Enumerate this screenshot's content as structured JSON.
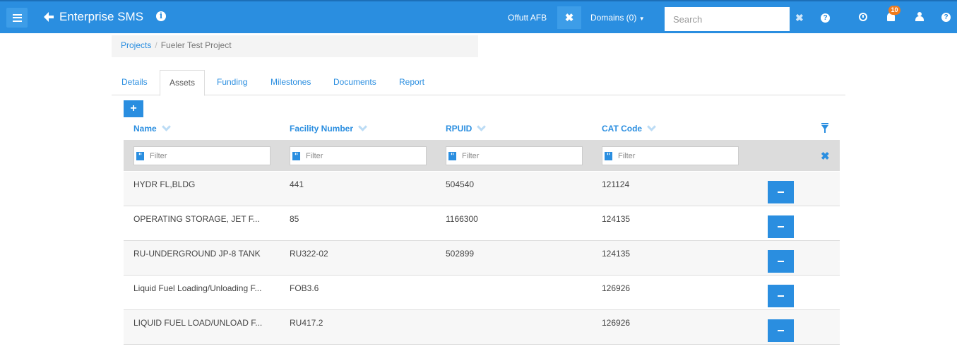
{
  "header": {
    "app_title": "Enterprise SMS",
    "base": "Offutt AFB",
    "domains_label": "Domains (0)",
    "search_placeholder": "Search",
    "notification_count": "10",
    "brand_color": "#2a8ee0",
    "icons": [
      "menu-icon",
      "logo-arrow-icon",
      "info-icon",
      "close-icon",
      "help-icon",
      "clock-icon",
      "bell-icon",
      "user-icon"
    ]
  },
  "breadcrumb": {
    "parent": "Projects",
    "separator": "/",
    "current": "Fueler Test Project"
  },
  "tabs": [
    {
      "label": "Details",
      "active": false
    },
    {
      "label": "Assets",
      "active": true
    },
    {
      "label": "Funding",
      "active": false
    },
    {
      "label": "Milestones",
      "active": false
    },
    {
      "label": "Documents",
      "active": false
    },
    {
      "label": "Report",
      "active": false
    }
  ],
  "table": {
    "add_label": "+",
    "columns": [
      "Name",
      "Facility Number",
      "RPUID",
      "CAT Code"
    ],
    "filter_placeholder": "Filter",
    "rows": [
      {
        "name": "HYDR FL,BLDG",
        "facility": "441",
        "rpuid": "504540",
        "cat": "121124"
      },
      {
        "name": "OPERATING STORAGE, JET F...",
        "facility": "85",
        "rpuid": "1166300",
        "cat": "124135"
      },
      {
        "name": "RU-UNDERGROUND JP-8 TANK",
        "facility": "RU322-02",
        "rpuid": "502899",
        "cat": "124135"
      },
      {
        "name": "Liquid Fuel Loading/Unloading F...",
        "facility": "FOB3.6",
        "rpuid": "",
        "cat": "126926"
      },
      {
        "name": "LIQUID FUEL LOAD/UNLOAD F...",
        "facility": "RU417.2",
        "rpuid": "",
        "cat": "126926"
      }
    ]
  }
}
